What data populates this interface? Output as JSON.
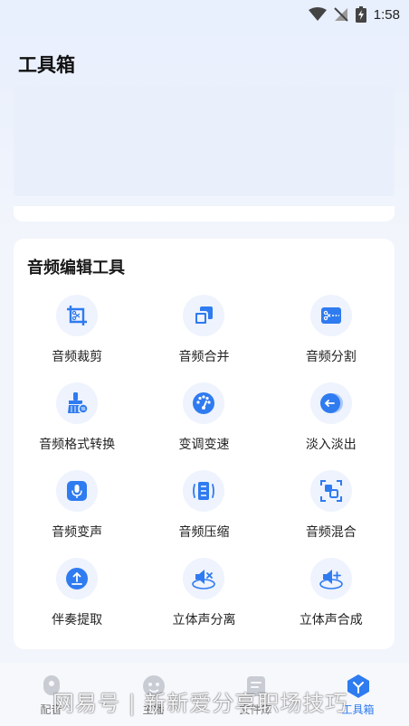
{
  "status_bar": {
    "time": "1:58"
  },
  "header": {
    "title": "工具箱"
  },
  "tools_section": {
    "title": "音频编辑工具",
    "tools": [
      {
        "label": "音频裁剪",
        "icon": "crop-scissors-icon"
      },
      {
        "label": "音频合并",
        "icon": "merge-squares-icon"
      },
      {
        "label": "音频分割",
        "icon": "split-scissors-icon"
      },
      {
        "label": "音频格式转换",
        "icon": "format-convert-brush-icon"
      },
      {
        "label": "变调变速",
        "icon": "speed-dial-icon"
      },
      {
        "label": "淡入淡出",
        "icon": "fade-arrow-icon"
      },
      {
        "label": "音频变声",
        "icon": "voice-mic-icon"
      },
      {
        "label": "音频压缩",
        "icon": "compress-icon"
      },
      {
        "label": "音频混合",
        "icon": "mix-icon"
      },
      {
        "label": "伴奏提取",
        "icon": "extract-upload-icon"
      },
      {
        "label": "立体声分离",
        "icon": "stereo-split-speaker-icon"
      },
      {
        "label": "立体声合成",
        "icon": "stereo-merge-speaker-icon"
      }
    ]
  },
  "bottom_nav": {
    "items": [
      {
        "label": "配音",
        "icon": "dub-icon",
        "active": false
      },
      {
        "label": "主播",
        "icon": "anchor-icon",
        "active": false
      },
      {
        "label": "文件库",
        "icon": "file-library-icon",
        "active": false
      },
      {
        "label": "工具箱",
        "icon": "toolbox-icon",
        "active": true
      }
    ]
  },
  "watermark": {
    "text": "网易号 | 新新爱分享职场技巧"
  },
  "colors": {
    "accent": "#2f7bf0",
    "icon_bg": "#eef3fd"
  }
}
